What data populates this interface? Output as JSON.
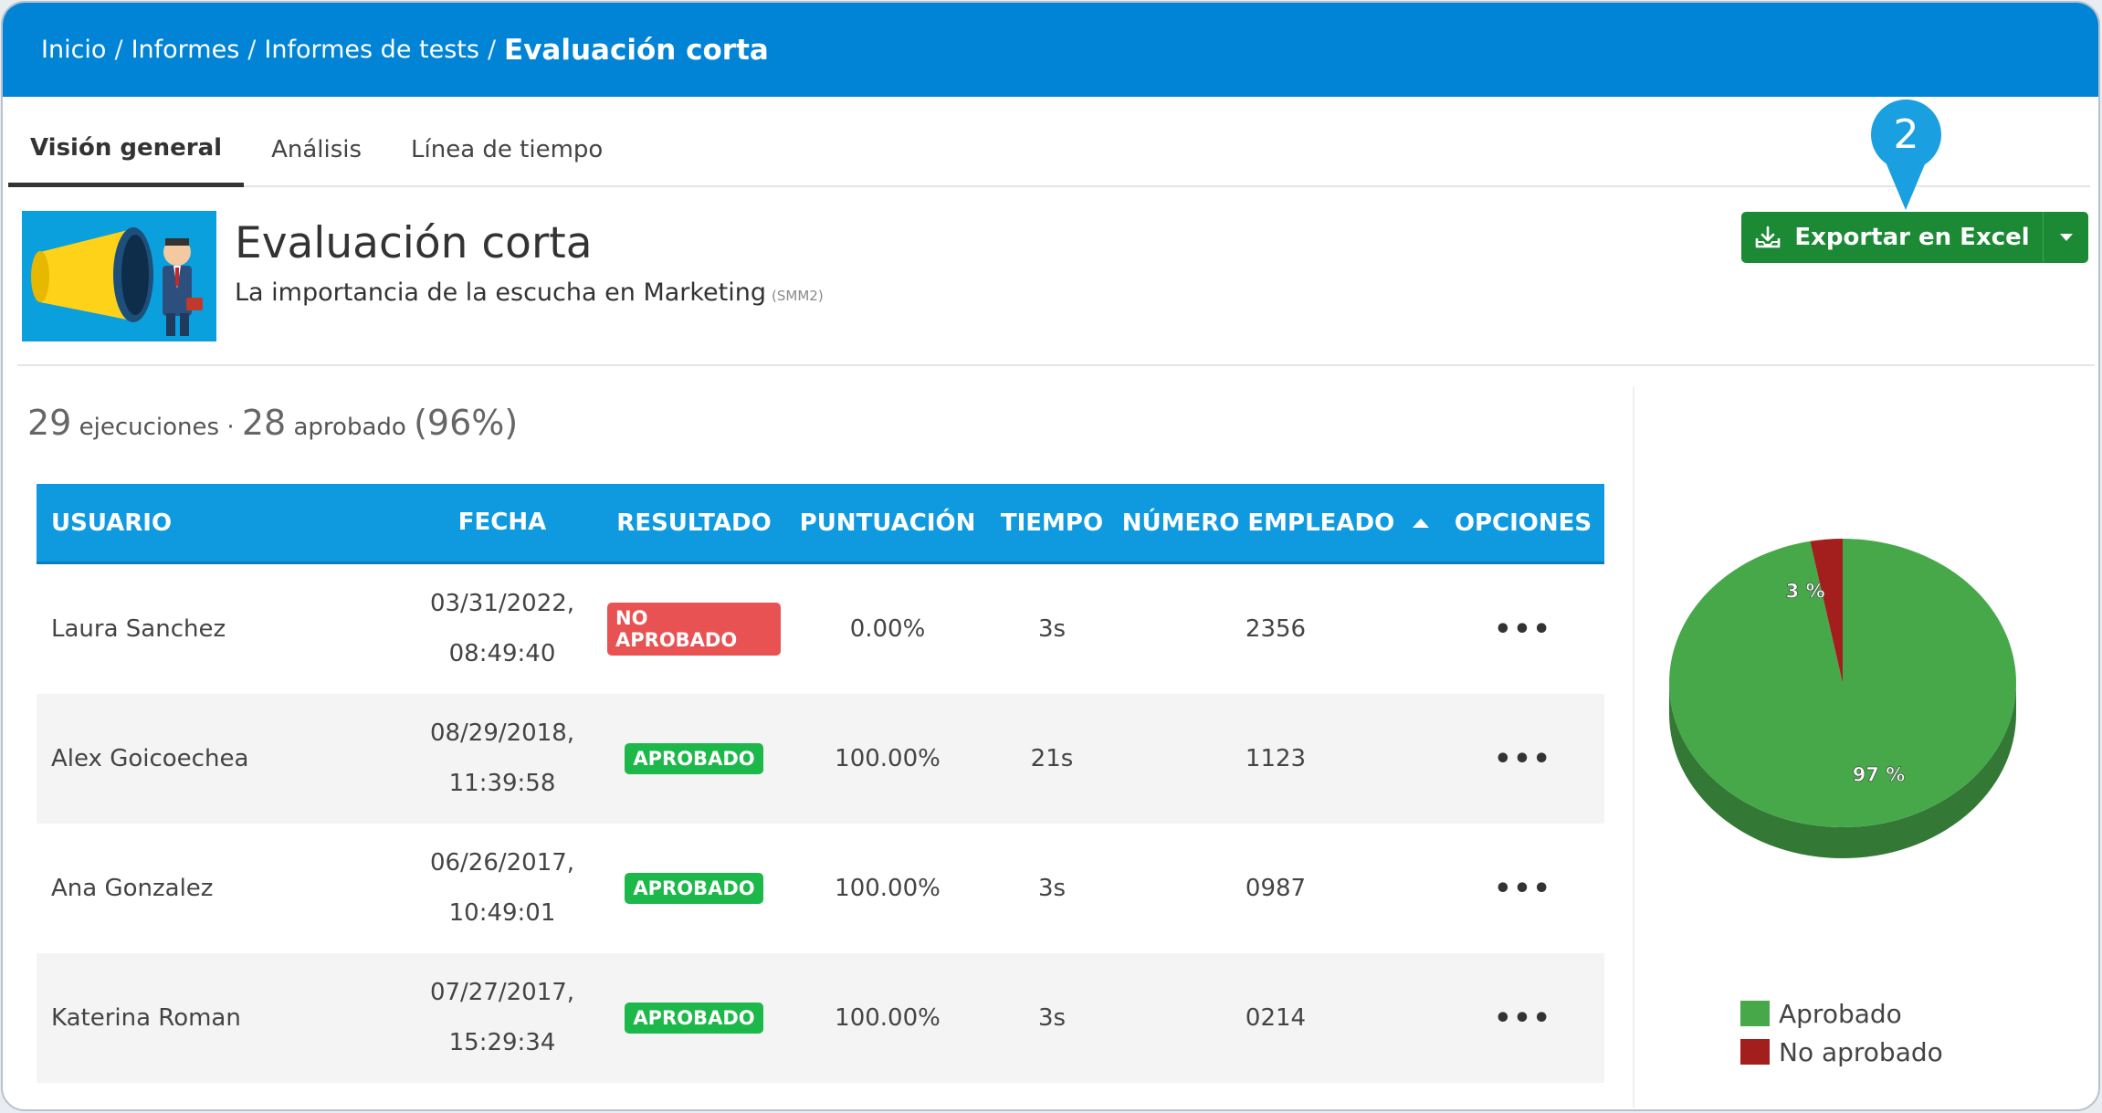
{
  "breadcrumb": {
    "items": [
      "Inicio",
      "Informes",
      "Informes de tests"
    ],
    "separator": "/",
    "current": "Evaluación corta"
  },
  "tabs": [
    {
      "label": "Visión general",
      "active": true
    },
    {
      "label": "Análisis",
      "active": false
    },
    {
      "label": "Línea de tiempo",
      "active": false
    }
  ],
  "callout_marker": "2",
  "course": {
    "title": "Evaluación corta",
    "subtitle": "La importancia de la escucha en Marketing",
    "code": "(SMM2)"
  },
  "export_button": {
    "label": "Exportar en Excel",
    "icon": "download-tray-icon"
  },
  "summary": {
    "executions": "29",
    "executions_label": "ejecuciones",
    "dot": "·",
    "passed": "28",
    "passed_label": "aprobado",
    "percent": "(96%)"
  },
  "table": {
    "headers": {
      "user": "USUARIO",
      "date": "FECHA",
      "result": "RESULTADO",
      "score": "PUNTUACIÓN",
      "time": "TIEMPO",
      "employee": "NÚMERO EMPLEADO",
      "options": "OPCIONES"
    },
    "rows": [
      {
        "user": "Laura Sanchez",
        "date": "03/31/2022,",
        "clock": "08:49:40",
        "result": "NO APROBADO",
        "status": "fail",
        "score": "0.00%",
        "time": "3s",
        "employee": "2356"
      },
      {
        "user": "Alex Goicoechea",
        "date": "08/29/2018,",
        "clock": "11:39:58",
        "result": "APROBADO",
        "status": "pass",
        "score": "100.00%",
        "time": "21s",
        "employee": "1123"
      },
      {
        "user": "Ana Gonzalez",
        "date": "06/26/2017,",
        "clock": "10:49:01",
        "result": "APROBADO",
        "status": "pass",
        "score": "100.00%",
        "time": "3s",
        "employee": "0987"
      },
      {
        "user": "Katerina Roman",
        "date": "07/27/2017,",
        "clock": "15:29:34",
        "result": "APROBADO",
        "status": "pass",
        "score": "100.00%",
        "time": "3s",
        "employee": "0214"
      }
    ],
    "options_glyph": "•••"
  },
  "chart_data": {
    "type": "pie",
    "slices": [
      {
        "label": "Aprobado",
        "value": 97,
        "display": "97 %",
        "color": "#47a84a"
      },
      {
        "label": "No aprobado",
        "value": 3,
        "display": "3 %",
        "color": "#a31f1d"
      }
    ],
    "legend_placement": "bottom"
  },
  "colors": {
    "header_blue": "#0284d6",
    "table_header": "#0f9ae0",
    "export_green": "#1c8a35",
    "pass_badge": "#1cb84a",
    "fail_badge": "#e85252"
  }
}
